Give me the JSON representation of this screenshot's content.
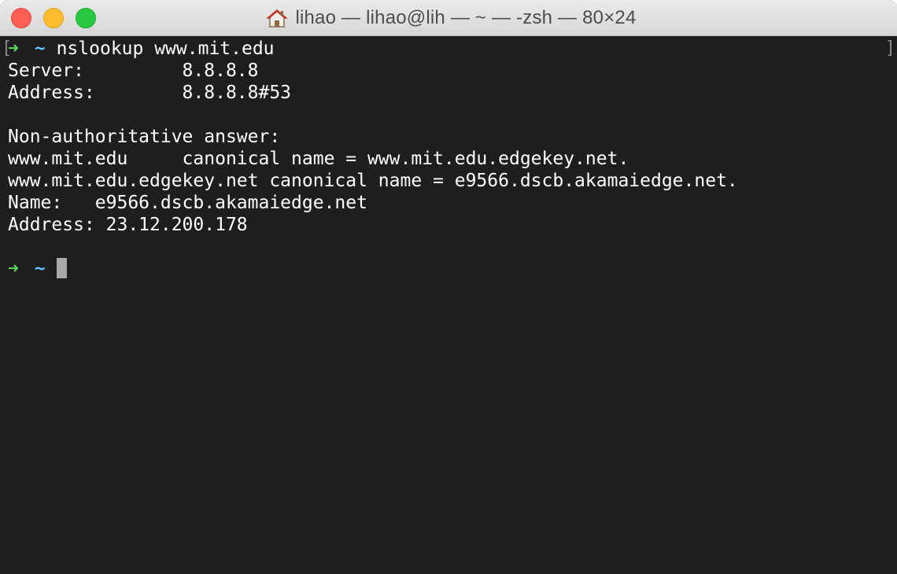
{
  "window": {
    "title": "lihao — lihao@lih — ~ — -zsh — 80×24"
  },
  "terminal": {
    "prompt_arrow": "➜",
    "prompt_dir": "~",
    "command": "nslookup www.mit.edu",
    "output": [
      "Server:         8.8.8.8",
      "Address:        8.8.8.8#53",
      "",
      "Non-authoritative answer:",
      "www.mit.edu     canonical name = www.mit.edu.edgekey.net.",
      "www.mit.edu.edgekey.net canonical name = e9566.dscb.akamaiedge.net.",
      "Name:   e9566.dscb.akamaiedge.net",
      "Address: 23.12.200.178",
      ""
    ],
    "scroll_bracket_left": "[",
    "scroll_bracket_right": "]"
  },
  "colors": {
    "background": "#1e1e1e",
    "prompt_arrow": "#5fd75f",
    "prompt_dir": "#5fc7ff",
    "text": "#ffffff",
    "cursor": "#a8a8a8"
  }
}
